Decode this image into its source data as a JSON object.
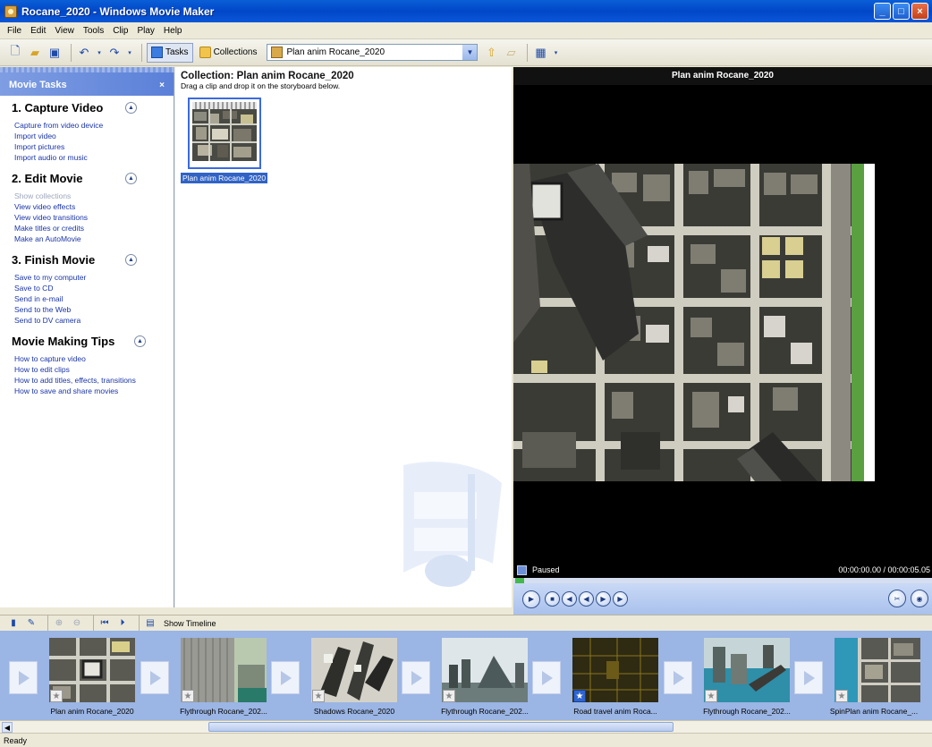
{
  "window": {
    "title": "Rocane_2020 - Windows Movie Maker"
  },
  "menu": [
    "File",
    "Edit",
    "View",
    "Tools",
    "Clip",
    "Play",
    "Help"
  ],
  "toolbar": {
    "tasks_label": "Tasks",
    "collections_label": "Collections",
    "collection_select_value": "Plan anim Rocane_2020"
  },
  "taskpane": {
    "header": "Movie Tasks",
    "close_glyph": "×",
    "sections": [
      {
        "title": "1. Capture Video",
        "links": [
          "Capture from video device",
          "Import video",
          "Import pictures",
          "Import audio or music"
        ]
      },
      {
        "title": "2. Edit Movie",
        "links": [
          "Show collections",
          "View video effects",
          "View video transitions",
          "Make titles or credits",
          "Make an AutoMovie"
        ]
      },
      {
        "title": "3. Finish Movie",
        "links": [
          "Save to my computer",
          "Save to CD",
          "Send in e-mail",
          "Send to the Web",
          "Send to DV camera"
        ]
      },
      {
        "title": "Movie Making Tips",
        "links": [
          "How to capture video",
          "How to edit clips",
          "How to add titles, effects, transitions",
          "How to save and share movies"
        ]
      }
    ]
  },
  "collection": {
    "title": "Collection: Plan anim Rocane_2020",
    "subtitle": "Drag a clip and drop it on the storyboard below.",
    "clip_label": "Plan anim Rocane_2020"
  },
  "preview": {
    "title": "Plan anim Rocane_2020",
    "status": "Paused",
    "time": "00:00:00.00 / 00:00:05.05"
  },
  "storyboard": {
    "show_timeline_label": "Show Timeline",
    "clips": [
      "Plan anim Rocane_2020",
      "Flythrough Rocane_202...",
      "Shadows Rocane_2020",
      "Flythrough Rocane_202...",
      "Road travel anim Roca...",
      "Flythrough Rocane_202...",
      "SpinPlan anim Rocane_..."
    ]
  },
  "statusbar": {
    "text": "Ready"
  }
}
